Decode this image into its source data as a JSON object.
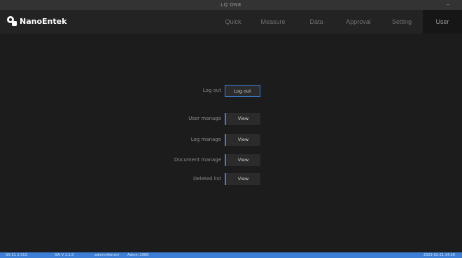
{
  "window": {
    "title": "LQ ONE",
    "minimize_symbol": "–"
  },
  "brand": {
    "name": "NanoEntek"
  },
  "nav": {
    "tabs": [
      {
        "label": "Quick"
      },
      {
        "label": "Measure"
      },
      {
        "label": "Data"
      },
      {
        "label": "Approval"
      },
      {
        "label": "Setting"
      },
      {
        "label": "User",
        "active": true
      }
    ]
  },
  "user_panel": {
    "logout": {
      "label": "Log out",
      "button": "Log out"
    },
    "user_manage": {
      "label": "User manage",
      "button": "View"
    },
    "log_manage": {
      "label": "Log manage",
      "button": "View"
    },
    "document_manage": {
      "label": "Document manage",
      "button": "View"
    },
    "deleted_list": {
      "label": "Deleted list",
      "button": "View"
    }
  },
  "status": {
    "s1": "SN 21 1 013",
    "s2": "SW V 1.1.0",
    "s3": "admin(Admin)",
    "s4": "Admin 1988",
    "right": "2023-02-21 14:26"
  },
  "colors": {
    "accent": "#3a7fd5",
    "statusbar": "#3d7fd6",
    "background": "#1c1c1c"
  }
}
